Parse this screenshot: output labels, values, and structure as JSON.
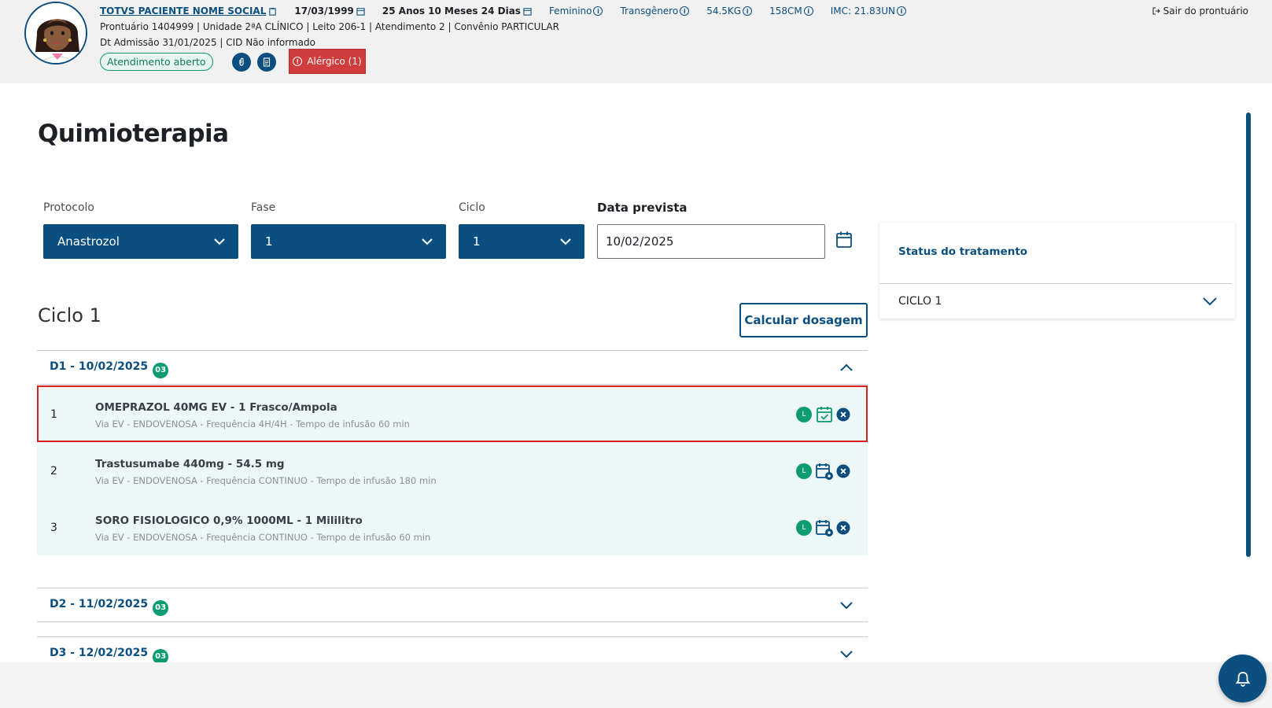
{
  "header": {
    "patient_name": "TOTVS PACIENTE NOME SOCIAL",
    "birth_date": "17/03/1999",
    "age": "25 Anos 10 Meses 24 Dias",
    "gender": "Feminino",
    "identity": "Transgênero",
    "weight": "54.5KG",
    "height": "158CM",
    "imc": "IMC: 21.83UN",
    "line2": "Prontuário 1404999  |  Unidade 2ªA CLÍNICO  |  Leito 206-1  |  Atendimento 2  |  Convênio PARTICULAR",
    "line3": "Dt Admissão 31/01/2025  |  CID Não informado",
    "status_badge": "Atendimento aberto",
    "allergy_label": "Alérgico (1)",
    "logout_label": "Sair do prontuário"
  },
  "page": {
    "title": "Quimioterapia"
  },
  "filters": {
    "protocolo_label": "Protocolo",
    "protocolo_value": "Anastrozol",
    "fase_label": "Fase",
    "fase_value": "1",
    "ciclo_label": "Ciclo",
    "ciclo_value": "1",
    "data_label": "Data prevista",
    "data_value": "10/02/2025"
  },
  "status_panel": {
    "title": "Status do tratamento",
    "row_label": "CICLO 1"
  },
  "cycle": {
    "title": "Ciclo 1",
    "calc_button": "Calcular dosagem",
    "days": [
      {
        "label": "D1 - 10/02/2025",
        "count": "03",
        "expanded": true,
        "items": [
          {
            "num": "1",
            "name": "OMEPRAZOL 40MG EV - 1 Frasco/Ampola",
            "detail": "Via EV - ENDOVENOSA - Frequência 4H/4H - Tempo de infusão 60 min",
            "badge": "L"
          },
          {
            "num": "2",
            "name": "Trastusumabe 440mg - 54.5 mg",
            "detail": "Via EV - ENDOVENOSA - Frequência CONTINUO - Tempo de infusão 180 min",
            "badge": "L"
          },
          {
            "num": "3",
            "name": "SORO FISIOLOGICO 0,9% 1000ML - 1 Mililitro",
            "detail": "Via EV - ENDOVENOSA - Frequência CONTINUO - Tempo de infusão 60 min",
            "badge": "L"
          }
        ]
      },
      {
        "label": "D2 - 11/02/2025",
        "count": "03",
        "expanded": false
      },
      {
        "label": "D3 - 12/02/2025",
        "count": "03",
        "expanded": false
      }
    ]
  },
  "colors": {
    "primary": "#0b4f80",
    "success": "#0c9b73",
    "danger": "#d13c3c",
    "row_bg": "#edf7f7"
  }
}
